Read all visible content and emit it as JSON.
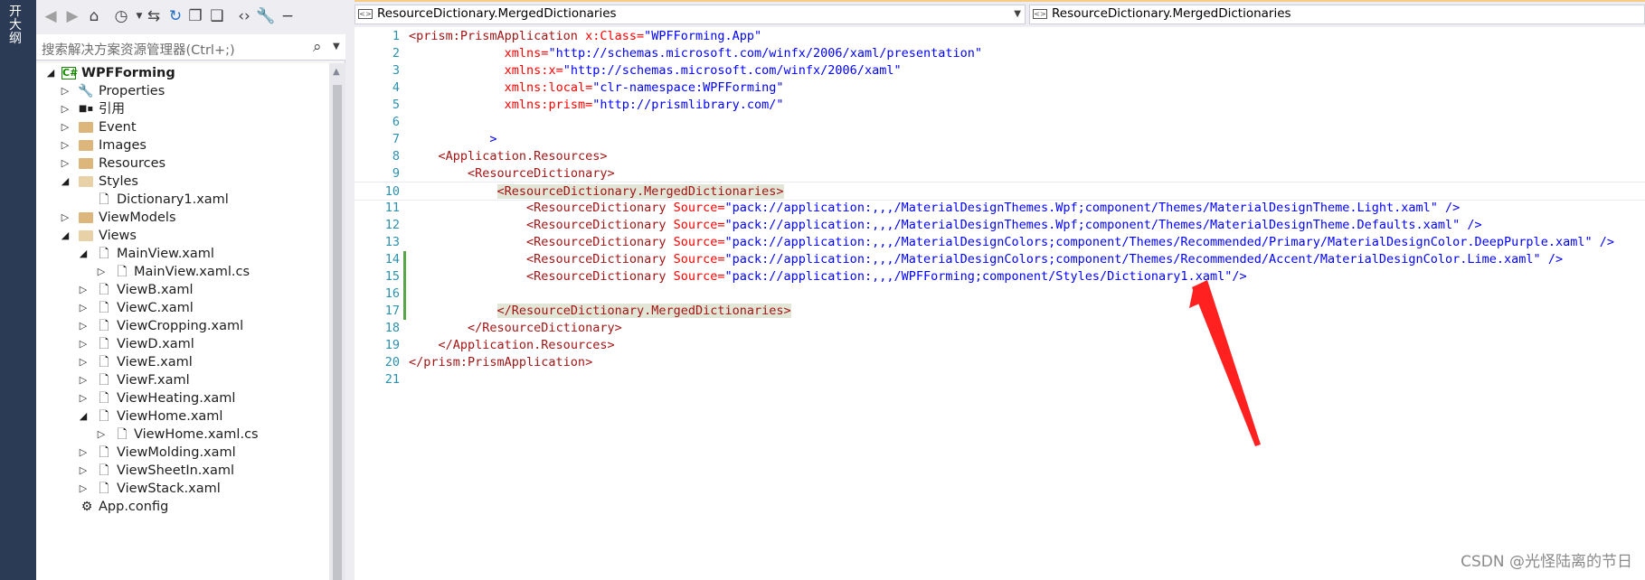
{
  "strip": {
    "text": "开大纲"
  },
  "explorer": {
    "search_placeholder": "搜索解决方案资源管理器(Ctrl+;)",
    "tree": [
      {
        "label": "WPFForming",
        "bold": true
      },
      {
        "label": "Properties"
      },
      {
        "label": "引用"
      },
      {
        "label": "Event"
      },
      {
        "label": "Images"
      },
      {
        "label": "Resources"
      },
      {
        "label": "Styles"
      },
      {
        "label": "Dictionary1.xaml"
      },
      {
        "label": "ViewModels"
      },
      {
        "label": "Views"
      },
      {
        "label": "MainView.xaml"
      },
      {
        "label": "MainView.xaml.cs"
      },
      {
        "label": "ViewB.xaml"
      },
      {
        "label": "ViewC.xaml"
      },
      {
        "label": "ViewCropping.xaml"
      },
      {
        "label": "ViewD.xaml"
      },
      {
        "label": "ViewE.xaml"
      },
      {
        "label": "ViewF.xaml"
      },
      {
        "label": "ViewHeating.xaml"
      },
      {
        "label": "ViewHome.xaml"
      },
      {
        "label": "ViewHome.xaml.cs"
      },
      {
        "label": "ViewMolding.xaml"
      },
      {
        "label": "ViewSheetIn.xaml"
      },
      {
        "label": "ViewStack.xaml"
      },
      {
        "label": "App.config"
      }
    ]
  },
  "editor": {
    "nav_left": "ResourceDictionary.MergedDictionaries",
    "nav_right": "ResourceDictionary.MergedDictionaries",
    "line_numbers": [
      "1",
      "2",
      "3",
      "4",
      "5",
      "6",
      "7",
      "8",
      "9",
      "10",
      "11",
      "12",
      "13",
      "14",
      "15",
      "16",
      "17",
      "18",
      "19",
      "20",
      "21"
    ],
    "code": {
      "l1_tag": "<prism:PrismApplication",
      "l1_attr": " x:Class=",
      "l1_val": "\"WPFForming.App\"",
      "l2_attr": "xmlns=",
      "l2_val": "\"http://schemas.microsoft.com/winfx/2006/xaml/presentation\"",
      "l3_attr": "xmlns:x=",
      "l3_val": "\"http://schemas.microsoft.com/winfx/2006/xaml\"",
      "l4_attr": "xmlns:local=",
      "l4_val": "\"clr-namespace:WPFForming\"",
      "l5_attr": "xmlns:prism=",
      "l5_val": "\"http://prismlibrary.com/\"",
      "l7": ">",
      "l8": "<Application.Resources>",
      "l9": "<ResourceDictionary>",
      "l10": "<ResourceDictionary.MergedDictionaries>",
      "rd_tag": "<ResourceDictionary",
      "rd_attr": " Source=",
      "l11_val": "\"pack://application:,,,/MaterialDesignThemes.Wpf;component/Themes/MaterialDesignTheme.Light.xaml\"",
      "l12_val": "\"pack://application:,,,/MaterialDesignThemes.Wpf;component/Themes/MaterialDesignTheme.Defaults.xaml\"",
      "l13_val": "\"pack://application:,,,/MaterialDesignColors;component/Themes/Recommended/Primary/MaterialDesignColor.DeepPurple.xaml\"",
      "l14_val": "\"pack://application:,,,/MaterialDesignColors;component/Themes/Recommended/Accent/MaterialDesignColor.Lime.xaml\"",
      "l15_val": "\"pack://application:,,,/WPFForming;component/Styles/Dictionary1.xaml\"",
      "close_sp": " />",
      "close_ns": "/>",
      "l17": "</ResourceDictionary.MergedDictionaries>",
      "l18": "</ResourceDictionary>",
      "l19": "</Application.Resources>",
      "l20": "</prism:PrismApplication>"
    }
  },
  "watermark": "CSDN @光怪陆离的节日",
  "colors": {
    "accent_strip": "#2b3a55",
    "tag": "#a31515",
    "attr": "#ff0000",
    "value": "#0000ff",
    "linenum": "#2b91af",
    "arrow": "#ff2020"
  }
}
